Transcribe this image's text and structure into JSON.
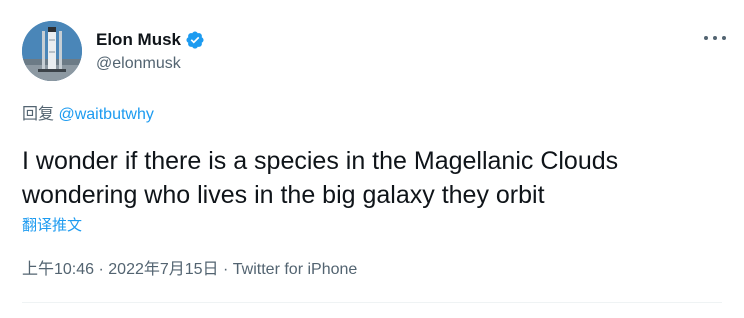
{
  "author": {
    "name": "Elon Musk",
    "handle": "@elonmusk",
    "verified": true,
    "avatar_icon": "avatar-rocket-image"
  },
  "more_icon": "more-horizontal-icon",
  "reply": {
    "prefix": "回复",
    "mention": "@waitbutwhy"
  },
  "tweet": {
    "text_line1": "I wonder if there is a species in the Magellanic Clouds",
    "text_line2": "wondering who lives in the big galaxy they orbit",
    "translate_label": "翻译推文"
  },
  "meta": {
    "time": "上午10:46",
    "separator1": " · ",
    "date": "2022年7月15日",
    "separator2": " · ",
    "source": "Twitter for iPhone"
  },
  "colors": {
    "accent": "#1d9bf0",
    "text": "#0f1419",
    "secondary": "#536471"
  }
}
